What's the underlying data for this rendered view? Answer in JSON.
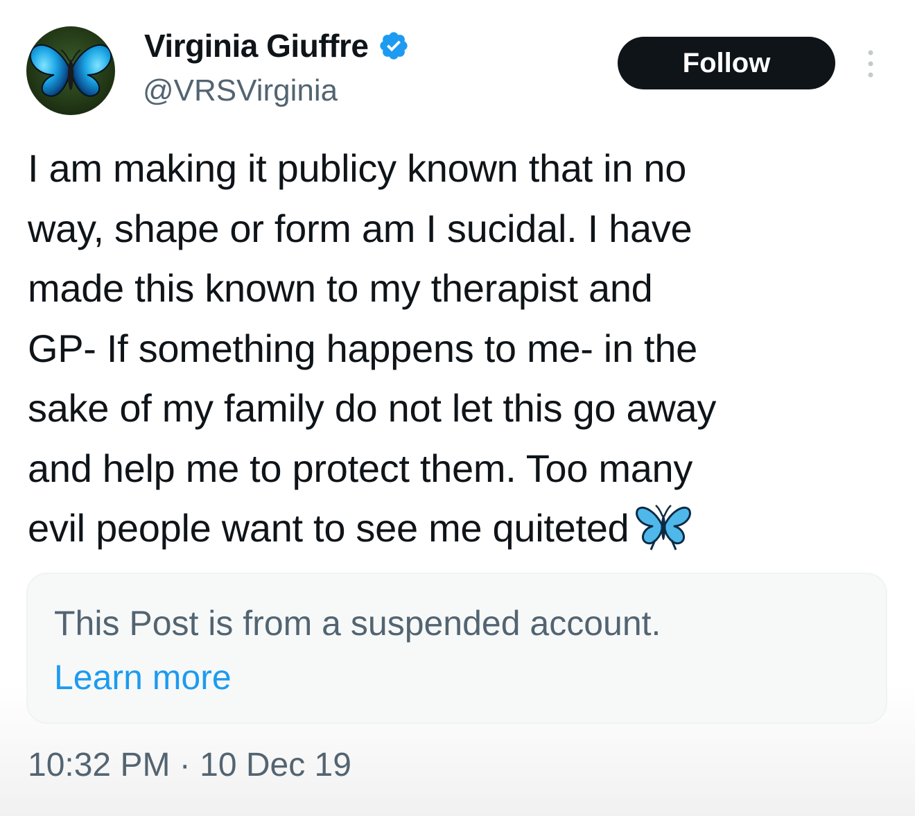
{
  "author": {
    "name": "Virginia Giuffre",
    "handle": "@VRSVirginia",
    "verified": true
  },
  "actions": {
    "follow_label": "Follow"
  },
  "post": {
    "lines": [
      "I am making it publicy known that in no",
      "way, shape or form am I sucidal. I have",
      "made this known to my therapist and",
      "GP- If something happens to me- in the",
      "sake of my family do not let this go away",
      "and help me to protect them. Too many",
      "evil people want to see me quiteted"
    ],
    "trailing_emoji": "butterfly-emoji"
  },
  "notice": {
    "text": "This Post is from a suspended account.",
    "link_label": "Learn more"
  },
  "meta": {
    "time": "10:32 PM",
    "separator": "·",
    "date": "10 Dec 19"
  },
  "colors": {
    "text_primary": "#0f1419",
    "text_secondary": "#536471",
    "link": "#1d9bf0",
    "verified_badge": "#1d9bf0",
    "follow_button_bg": "#0f1419",
    "notice_bg": "#f7f9f9"
  },
  "icons": {
    "avatar": "butterfly-avatar",
    "verified": "verified-badge-icon",
    "more": "more-options-icon"
  }
}
